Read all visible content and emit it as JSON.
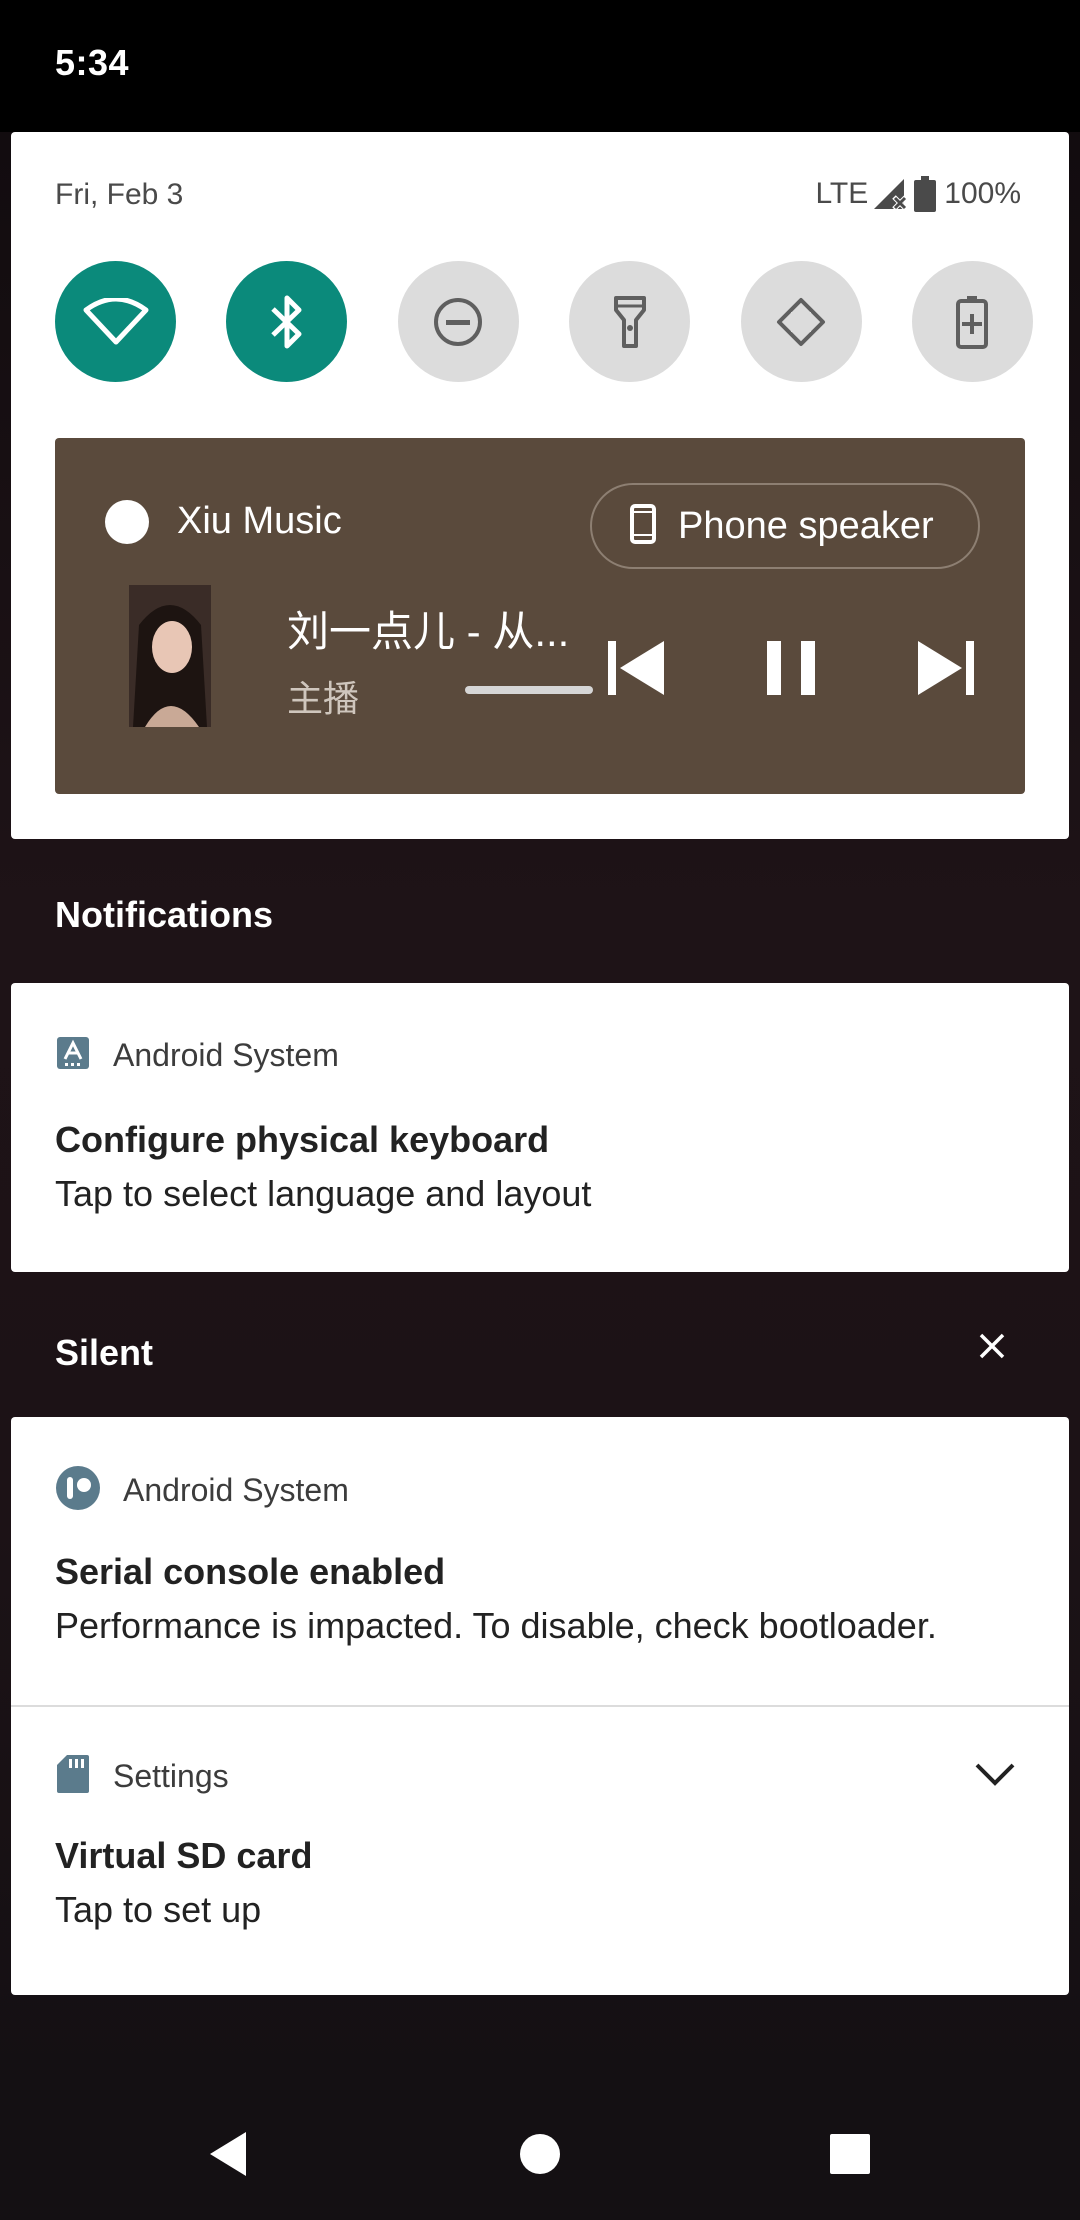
{
  "status_bar": {
    "time": "5:34"
  },
  "quick_settings": {
    "date": "Fri, Feb 3",
    "network": "LTE",
    "battery": "100%",
    "tiles": [
      {
        "name": "wifi",
        "icon": "wifi-icon",
        "active": true
      },
      {
        "name": "bluetooth",
        "icon": "bluetooth-icon",
        "active": true
      },
      {
        "name": "do-not-disturb",
        "icon": "do-not-disturb-icon",
        "active": false
      },
      {
        "name": "flashlight",
        "icon": "flashlight-icon",
        "active": false
      },
      {
        "name": "auto-rotate",
        "icon": "auto-rotate-icon",
        "active": false
      },
      {
        "name": "battery-saver",
        "icon": "battery-saver-icon",
        "active": false
      }
    ],
    "accent_color": "#0b8a7b"
  },
  "media": {
    "app_name": "Xiu Music",
    "output_label": "Phone speaker",
    "title": "刘一点儿 - 从...",
    "artist": "主播",
    "card_color": "#5a4a3c"
  },
  "sections": {
    "notifications_header": "Notifications",
    "silent_header": "Silent"
  },
  "notifications": [
    {
      "app": "Android System",
      "title": "Configure physical keyboard",
      "text": "Tap to select language and layout",
      "icon": "keyboard-a-icon"
    },
    {
      "app": "Android System",
      "title": "Serial console enabled",
      "text": "Performance is impacted. To disable, check bootloader.",
      "icon": "android-system-icon"
    },
    {
      "app": "Settings",
      "title": "Virtual SD card",
      "text": "Tap to set up",
      "icon": "sd-card-icon"
    }
  ]
}
